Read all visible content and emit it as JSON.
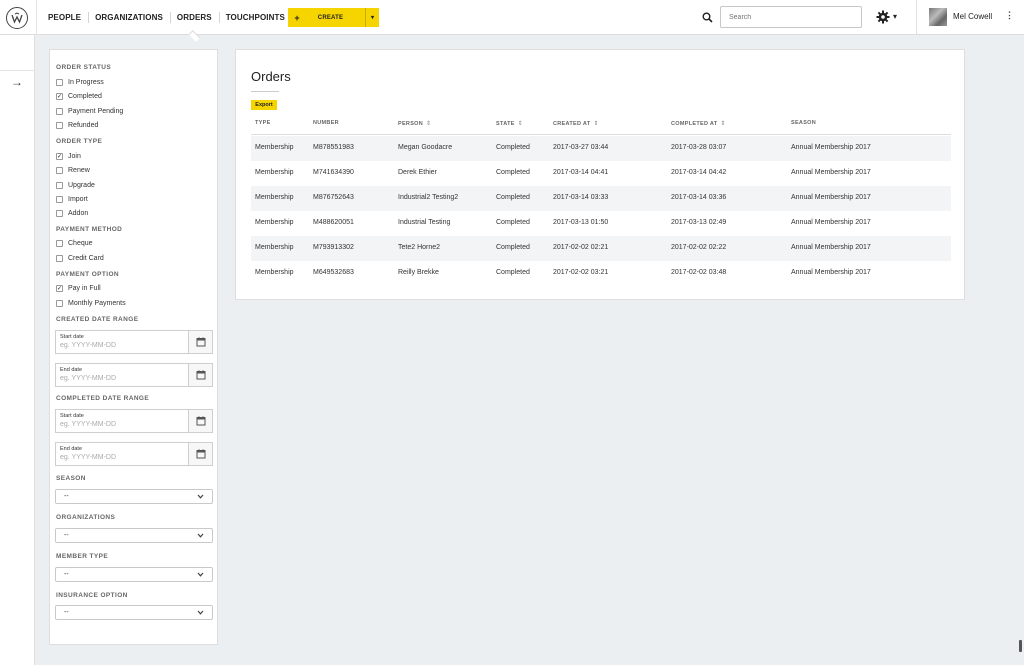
{
  "nav": {
    "items": [
      {
        "label": "PEOPLE"
      },
      {
        "label": "ORGANIZATIONS"
      },
      {
        "label": "ORDERS",
        "active": true
      },
      {
        "label": "TOUCHPOINTS"
      }
    ],
    "create": {
      "plus": "+",
      "label": "CREATE",
      "caret": "▾"
    },
    "search_placeholder": "Search",
    "settings_caret": "▾",
    "user_name": "Mel Cowell",
    "kebab": "⋮"
  },
  "rail": {
    "arrow": "→"
  },
  "filters": {
    "order_status": {
      "title": "ORDER STATUS",
      "options": [
        {
          "label": "In Progress",
          "checked": false
        },
        {
          "label": "Completed",
          "checked": true
        },
        {
          "label": "Payment Pending",
          "checked": false
        },
        {
          "label": "Refunded",
          "checked": false
        }
      ]
    },
    "order_type": {
      "title": "ORDER TYPE",
      "options": [
        {
          "label": "Join",
          "checked": true
        },
        {
          "label": "Renew",
          "checked": false
        },
        {
          "label": "Upgrade",
          "checked": false
        },
        {
          "label": "Import",
          "checked": false
        },
        {
          "label": "Addon",
          "checked": false
        }
      ]
    },
    "payment_method": {
      "title": "PAYMENT METHOD",
      "options": [
        {
          "label": "Cheque",
          "checked": false
        },
        {
          "label": "Credit Card",
          "checked": false
        }
      ]
    },
    "payment_option": {
      "title": "PAYMENT OPTION",
      "options": [
        {
          "label": "Pay in Full",
          "checked": true
        },
        {
          "label": "Monthly Payments",
          "checked": false
        }
      ]
    },
    "created_range": {
      "title": "CREATED DATE RANGE",
      "start_label": "Start date",
      "end_label": "End date",
      "placeholder": "eg. YYYY-MM-DD"
    },
    "completed_range": {
      "title": "COMPLETED DATE RANGE",
      "start_label": "Start date",
      "end_label": "End date",
      "placeholder": "eg. YYYY-MM-DD"
    },
    "season": {
      "title": "SEASON",
      "value": "--"
    },
    "organizations": {
      "title": "ORGANIZATIONS",
      "value": "--"
    },
    "member_type": {
      "title": "MEMBER TYPE",
      "value": "--"
    },
    "insurance_option": {
      "title": "INSURANCE OPTION",
      "value": "--"
    }
  },
  "orders": {
    "title": "Orders",
    "export_label": "Export",
    "columns": [
      {
        "label": "TYPE",
        "sortable": false
      },
      {
        "label": "NUMBER",
        "sortable": false
      },
      {
        "label": "PERSON",
        "sortable": true
      },
      {
        "label": "STATE",
        "sortable": true
      },
      {
        "label": "CREATED AT",
        "sortable": true
      },
      {
        "label": "COMPLETED AT",
        "sortable": true
      },
      {
        "label": "SEASON",
        "sortable": false
      }
    ],
    "sort_glyph": "⇕",
    "rows": [
      [
        "Membership",
        "M878551983",
        "Megan Goodacre",
        "Completed",
        "2017-03-27 03:44",
        "2017-03-28 03:07",
        "Annual Membership 2017"
      ],
      [
        "Membership",
        "M741634390",
        "Derek Ethier",
        "Completed",
        "2017-03-14 04:41",
        "2017-03-14 04:42",
        "Annual Membership 2017"
      ],
      [
        "Membership",
        "M876752643",
        "Industrial2 Testing2",
        "Completed",
        "2017-03-14 03:33",
        "2017-03-14 03:36",
        "Annual Membership 2017"
      ],
      [
        "Membership",
        "M488620051",
        "Industrial Testing",
        "Completed",
        "2017-03-13 01:50",
        "2017-03-13 02:49",
        "Annual Membership 2017"
      ],
      [
        "Membership",
        "M793913302",
        "Tete2 Horne2",
        "Completed",
        "2017-02-02 02:21",
        "2017-02-02 02:22",
        "Annual Membership 2017"
      ],
      [
        "Membership",
        "M649532683",
        "Reilly Brekke",
        "Completed",
        "2017-02-02 03:21",
        "2017-02-02 03:48",
        "Annual Membership 2017"
      ]
    ]
  }
}
